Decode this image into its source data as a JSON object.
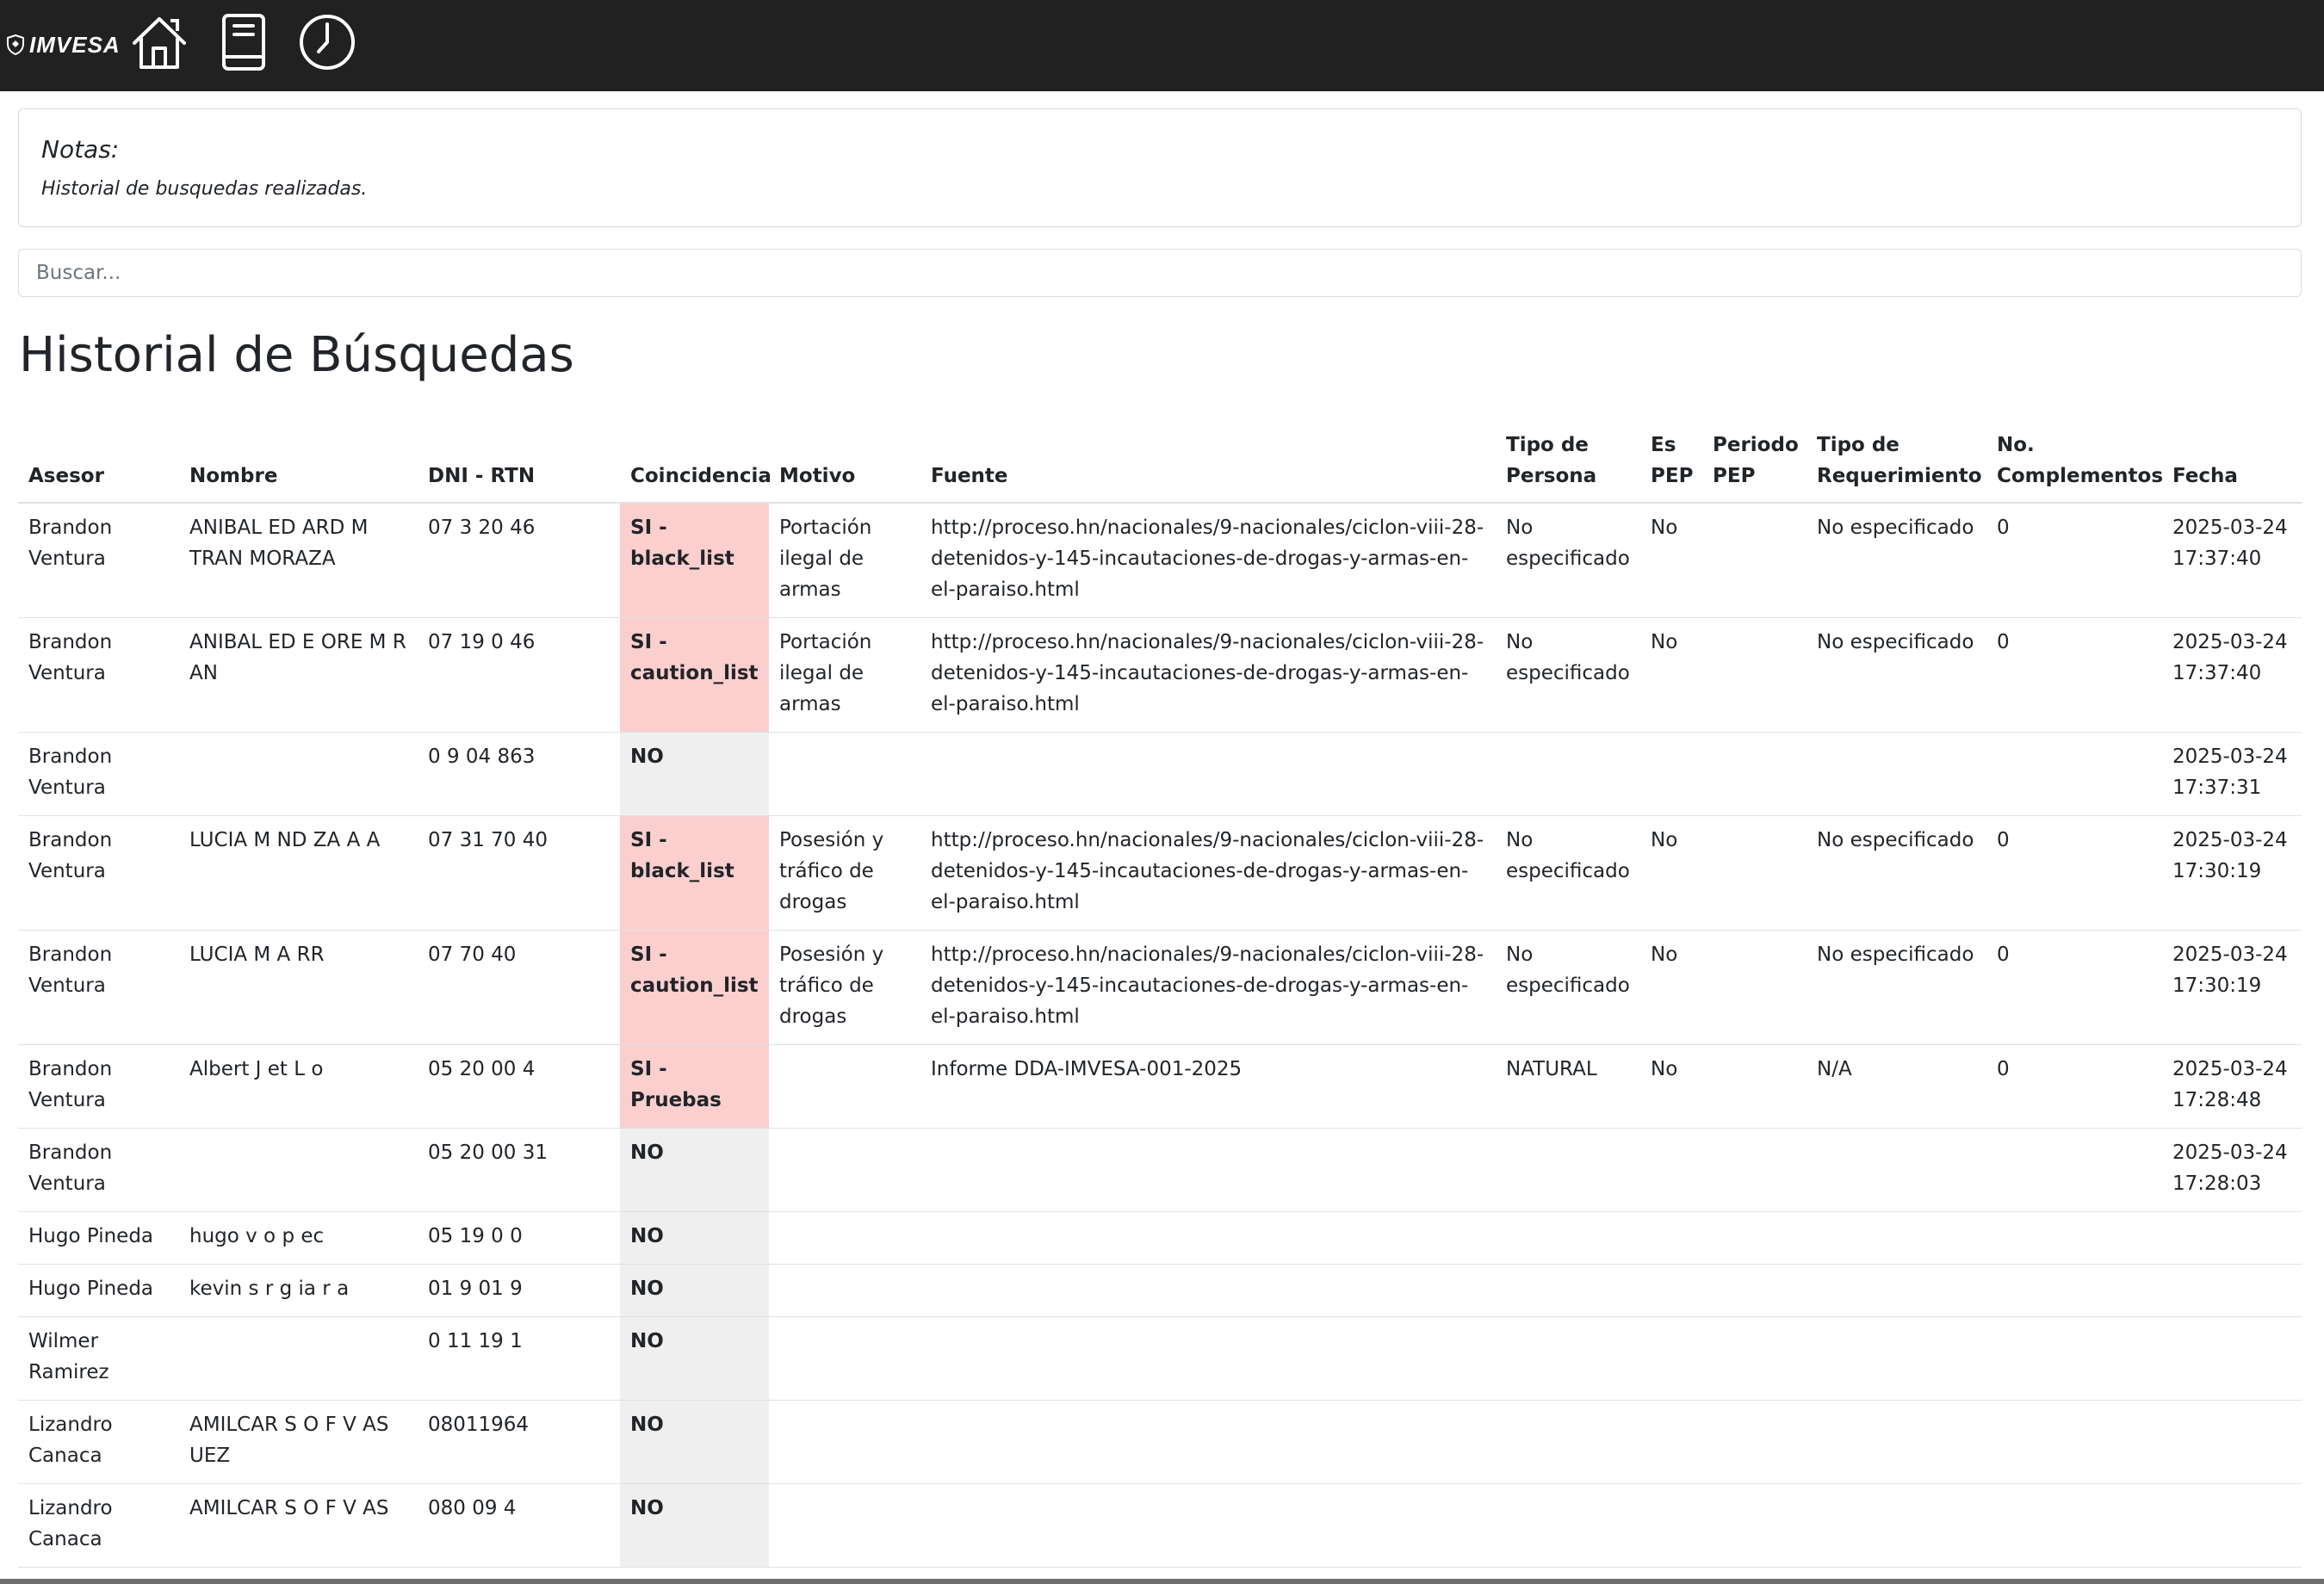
{
  "header": {
    "logo_text": "IMVESA",
    "nav": [
      "home-icon",
      "book-icon",
      "clock-icon"
    ]
  },
  "notes": {
    "title": "Notas:",
    "text": "Historial de busquedas realizadas."
  },
  "search": {
    "placeholder": "Buscar..."
  },
  "page_title": "Historial de Búsquedas",
  "table": {
    "columns": [
      "Asesor",
      "Nombre",
      "DNI - RTN",
      "Coincidencia",
      "Motivo",
      "Fuente",
      "Tipo de Persona",
      "Es PEP",
      "Periodo PEP",
      "Tipo de Requerimiento",
      "No. Complementos",
      "Fecha"
    ],
    "rows": [
      {
        "asesor": "Brandon Ventura",
        "nombre": "ANIBAL ED ARD M TRAN MORAZA",
        "dni": "07 3 20 46",
        "coincidencia": "SI - black_list",
        "motivo": "Portación ilegal de armas",
        "fuente": "http://proceso.hn/nacionales/9-nacionales/ciclon-viii-28-detenidos-y-145-incautaciones-de-drogas-y-armas-en-el-paraiso.html",
        "tipo_persona": "No especificado",
        "es_pep": "No",
        "periodo_pep": "",
        "tipo_req": "No especificado",
        "complementos": "0",
        "fecha": "2025-03-24 17:37:40"
      },
      {
        "asesor": "Brandon Ventura",
        "nombre": "ANIBAL ED E ORE M R AN",
        "dni": "07 19 0 46",
        "coincidencia": "SI - caution_list",
        "motivo": "Portación ilegal de armas",
        "fuente": "http://proceso.hn/nacionales/9-nacionales/ciclon-viii-28-detenidos-y-145-incautaciones-de-drogas-y-armas-en-el-paraiso.html",
        "tipo_persona": "No especificado",
        "es_pep": "No",
        "periodo_pep": "",
        "tipo_req": "No especificado",
        "complementos": "0",
        "fecha": "2025-03-24 17:37:40"
      },
      {
        "asesor": "Brandon Ventura",
        "nombre": "",
        "dni": "0 9 04 863",
        "coincidencia": "NO",
        "motivo": "",
        "fuente": "",
        "tipo_persona": "",
        "es_pep": "",
        "periodo_pep": "",
        "tipo_req": "",
        "complementos": "",
        "fecha": "2025-03-24 17:37:31"
      },
      {
        "asesor": "Brandon Ventura",
        "nombre": "LUCIA M ND ZA A A",
        "dni": "07 31 70 40",
        "coincidencia": "SI - black_list",
        "motivo": "Posesión y tráfico de drogas",
        "fuente": "http://proceso.hn/nacionales/9-nacionales/ciclon-viii-28-detenidos-y-145-incautaciones-de-drogas-y-armas-en-el-paraiso.html",
        "tipo_persona": "No especificado",
        "es_pep": "No",
        "periodo_pep": "",
        "tipo_req": "No especificado",
        "complementos": "0",
        "fecha": "2025-03-24 17:30:19"
      },
      {
        "asesor": "Brandon Ventura",
        "nombre": "LUCIA M A RR",
        "dni": "07 70 40",
        "coincidencia": "SI - caution_list",
        "motivo": "Posesión y tráfico de drogas",
        "fuente": "http://proceso.hn/nacionales/9-nacionales/ciclon-viii-28-detenidos-y-145-incautaciones-de-drogas-y-armas-en-el-paraiso.html",
        "tipo_persona": "No especificado",
        "es_pep": "No",
        "periodo_pep": "",
        "tipo_req": "No especificado",
        "complementos": "0",
        "fecha": "2025-03-24 17:30:19"
      },
      {
        "asesor": "Brandon Ventura",
        "nombre": "Albert J et L o",
        "dni": "05 20 00 4",
        "coincidencia": "SI - Pruebas",
        "motivo": "",
        "fuente": "Informe DDA-IMVESA-001-2025",
        "tipo_persona": "NATURAL",
        "es_pep": "No",
        "periodo_pep": "",
        "tipo_req": "N/A",
        "complementos": "0",
        "fecha": "2025-03-24 17:28:48"
      },
      {
        "asesor": "Brandon Ventura",
        "nombre": "",
        "dni": "05 20 00 31",
        "coincidencia": "NO",
        "motivo": "",
        "fuente": "",
        "tipo_persona": "",
        "es_pep": "",
        "periodo_pep": "",
        "tipo_req": "",
        "complementos": "",
        "fecha": "2025-03-24 17:28:03"
      },
      {
        "asesor": "Hugo Pineda",
        "nombre": "hugo v o p ec",
        "dni": "05 19 0 0",
        "coincidencia": "NO",
        "motivo": "",
        "fuente": "",
        "tipo_persona": "",
        "es_pep": "",
        "periodo_pep": "",
        "tipo_req": "",
        "complementos": "",
        "fecha": ""
      },
      {
        "asesor": "Hugo Pineda",
        "nombre": "kevin s r g ia r a",
        "dni": "01 9 01 9",
        "coincidencia": "NO",
        "motivo": "",
        "fuente": "",
        "tipo_persona": "",
        "es_pep": "",
        "periodo_pep": "",
        "tipo_req": "",
        "complementos": "",
        "fecha": ""
      },
      {
        "asesor": "Wilmer Ramirez",
        "nombre": "",
        "dni": "0 11 19 1",
        "coincidencia": "NO",
        "motivo": "",
        "fuente": "",
        "tipo_persona": "",
        "es_pep": "",
        "periodo_pep": "",
        "tipo_req": "",
        "complementos": "",
        "fecha": ""
      },
      {
        "asesor": "Lizandro Canaca",
        "nombre": "AMILCAR S O F V AS UEZ",
        "dni": "08011964",
        "coincidencia": "NO",
        "motivo": "",
        "fuente": "",
        "tipo_persona": "",
        "es_pep": "",
        "periodo_pep": "",
        "tipo_req": "",
        "complementos": "",
        "fecha": ""
      },
      {
        "asesor": "Lizandro Canaca",
        "nombre": "AMILCAR S O F V AS",
        "dni": "080 09 4",
        "coincidencia": "NO",
        "motivo": "",
        "fuente": "",
        "tipo_persona": "",
        "es_pep": "",
        "periodo_pep": "",
        "tipo_req": "",
        "complementos": "",
        "fecha": ""
      }
    ]
  }
}
